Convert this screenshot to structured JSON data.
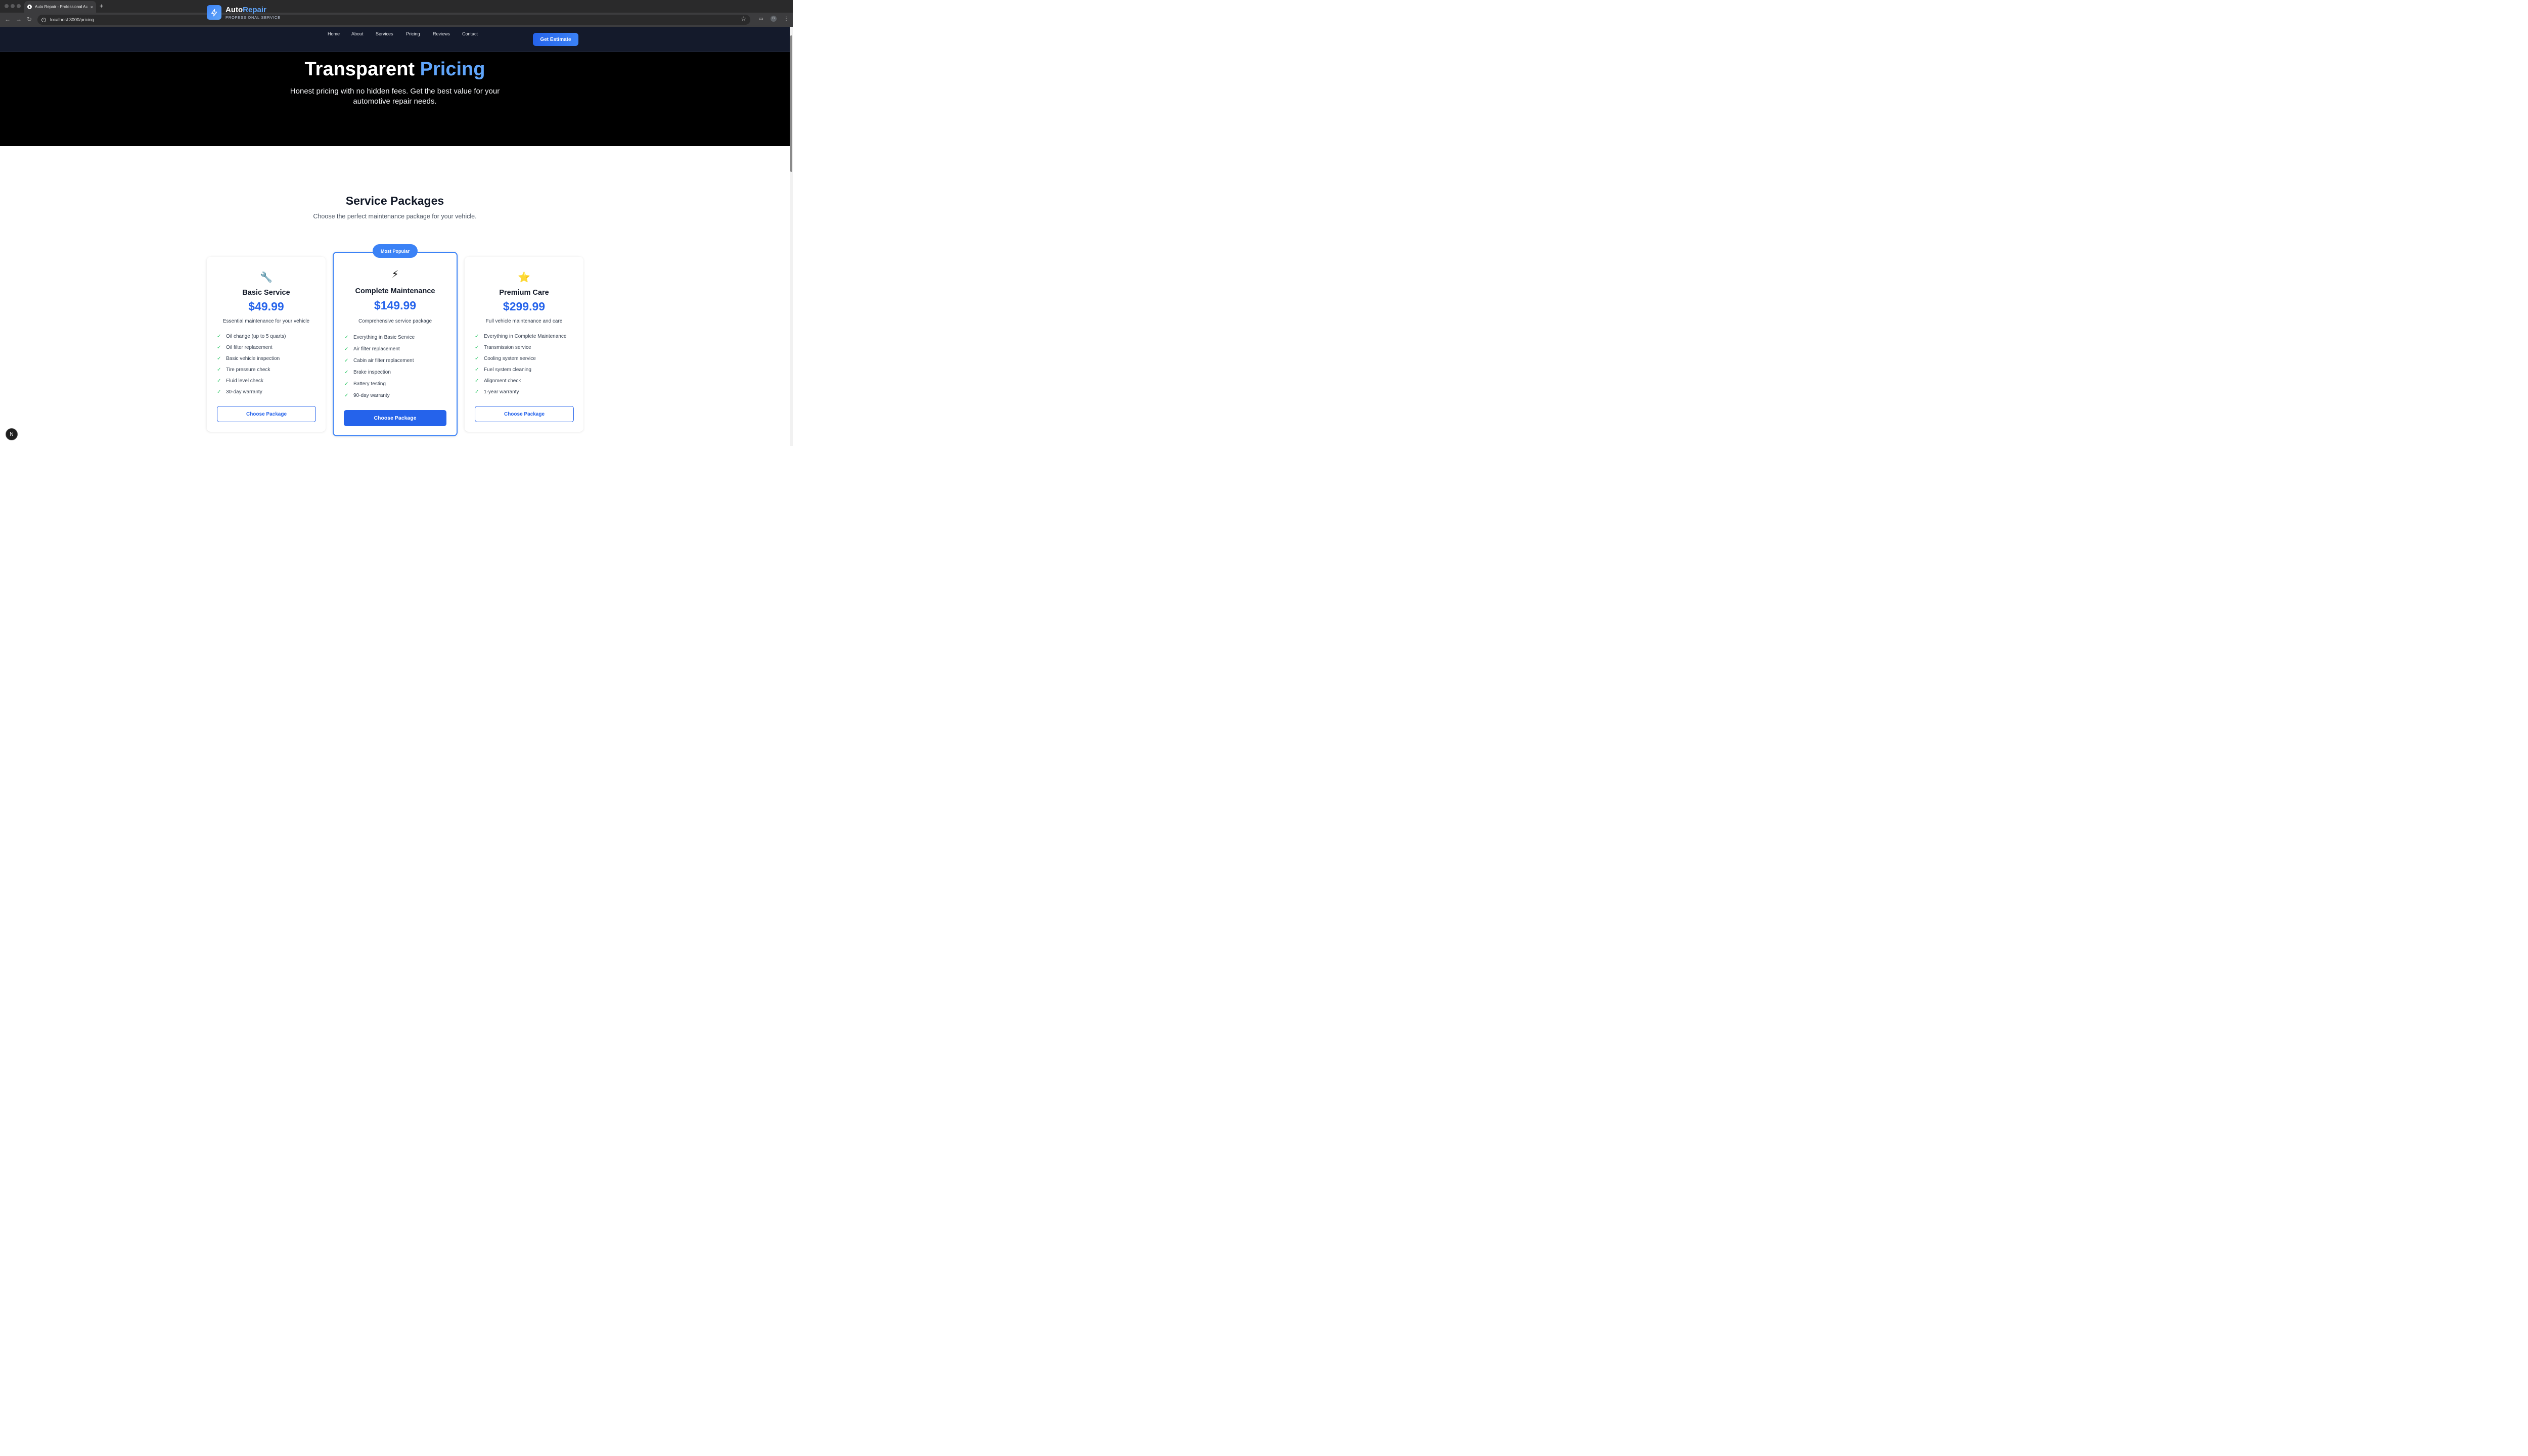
{
  "browser": {
    "tab_title": "Auto Repair - Professional Au",
    "url": "localhost:3000/pricing",
    "new_tab_label": "+",
    "close_label": "×",
    "profile_initial": "G"
  },
  "header": {
    "brand_main": "Auto",
    "brand_accent": "Repair",
    "brand_sub": "PROFESSIONAL SERVICE",
    "nav": [
      "Home",
      "About",
      "Services",
      "Pricing",
      "Reviews",
      "Contact"
    ],
    "cta": "Get Estimate"
  },
  "hero": {
    "title_main": "Transparent ",
    "title_accent": "Pricing",
    "subtitle": "Honest pricing with no hidden fees. Get the best value for your automotive repair needs."
  },
  "packages": {
    "title": "Service Packages",
    "subtitle": "Choose the perfect maintenance package for your vehicle.",
    "popular_badge": "Most Popular",
    "cards": [
      {
        "icon": "🔧",
        "name": "Basic Service",
        "price": "$49.99",
        "description": "Essential maintenance for your vehicle",
        "features": [
          "Oil change (up to 5 quarts)",
          "Oil filter replacement",
          "Basic vehicle inspection",
          "Tire pressure check",
          "Fluid level check",
          "30-day warranty"
        ],
        "button": "Choose Package"
      },
      {
        "icon": "⚡",
        "name": "Complete Maintenance",
        "price": "$149.99",
        "description": "Comprehensive service package",
        "features": [
          "Everything in Basic Service",
          "Air filter replacement",
          "Cabin air filter replacement",
          "Brake inspection",
          "Battery testing",
          "90-day warranty"
        ],
        "button": "Choose Package"
      },
      {
        "icon": "⭐",
        "name": "Premium Care",
        "price": "$299.99",
        "description": "Full vehicle maintenance and care",
        "features": [
          "Everything in Complete Maintenance",
          "Transmission service",
          "Cooling system service",
          "Fuel system cleaning",
          "Alignment check",
          "1-year warranty"
        ],
        "button": "Choose Package"
      }
    ]
  },
  "colors": {
    "accent": "#3b82f6",
    "price": "#2563eb",
    "header_bg": "#141a2b",
    "hero_bg": "#000000",
    "check": "#22c55e"
  },
  "misc": {
    "check_glyph": "✓",
    "nextjs_badge": "N"
  }
}
